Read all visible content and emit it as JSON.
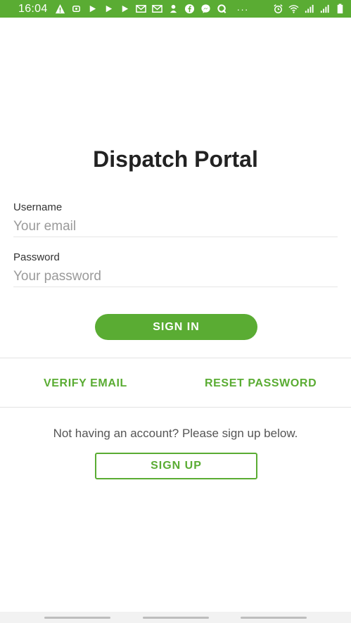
{
  "status_bar": {
    "time": "16:04",
    "background_color": "#5aac33",
    "left_icons": [
      "warning-icon",
      "app-icon",
      "play-icon",
      "play-icon",
      "play-icon",
      "gmail-icon",
      "gmail-icon",
      "app-icon",
      "facebook-icon",
      "messenger-icon",
      "q-icon"
    ],
    "more": "···",
    "right_icons": [
      "alarm-icon",
      "wifi-icon",
      "signal-icon",
      "signal-icon",
      "battery-icon"
    ]
  },
  "app": {
    "title": "Dispatch Portal",
    "accent_color": "#5aac33"
  },
  "form": {
    "username": {
      "label": "Username",
      "placeholder": "Your email",
      "value": ""
    },
    "password": {
      "label": "Password",
      "placeholder": "Your password",
      "value": ""
    },
    "sign_in_label": "SIGN IN"
  },
  "links": {
    "verify_email": "VERIFY EMAIL",
    "reset_password": "RESET PASSWORD"
  },
  "signup": {
    "prompt": "Not having an account? Please sign up below.",
    "button_label": "SIGN UP"
  }
}
